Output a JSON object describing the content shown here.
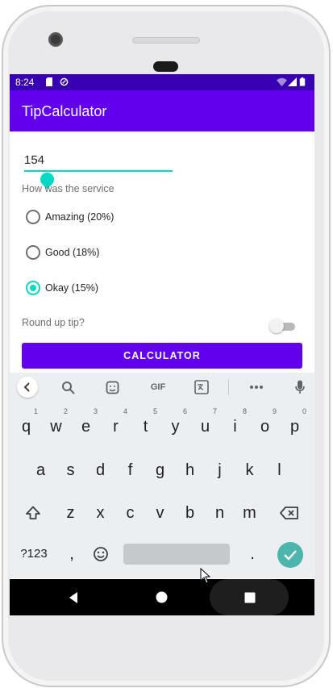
{
  "status_bar": {
    "time": "8:24",
    "color": "#3700b3"
  },
  "app_bar": {
    "title": "TipCalculator",
    "color": "#6200ee"
  },
  "form": {
    "amount_value": "154",
    "service_question": "How was the service",
    "options": [
      {
        "label": "Amazing (20%)",
        "selected": false
      },
      {
        "label": "Good (18%)",
        "selected": false
      },
      {
        "label": "Okay (15%)",
        "selected": true
      }
    ],
    "round_up_label": "Round up tip?",
    "round_up_on": false,
    "calculate_label": "CALCULATOR",
    "accent_color": "#03dac5"
  },
  "keyboard": {
    "toolbar": {
      "gif_label": "GIF"
    },
    "row1": [
      {
        "key": "q",
        "hint": "1"
      },
      {
        "key": "w",
        "hint": "2"
      },
      {
        "key": "e",
        "hint": "3"
      },
      {
        "key": "r",
        "hint": "4"
      },
      {
        "key": "t",
        "hint": "5"
      },
      {
        "key": "y",
        "hint": "6"
      },
      {
        "key": "u",
        "hint": "7"
      },
      {
        "key": "i",
        "hint": "8"
      },
      {
        "key": "o",
        "hint": "9"
      },
      {
        "key": "p",
        "hint": "0"
      }
    ],
    "row2": [
      "a",
      "s",
      "d",
      "f",
      "g",
      "h",
      "j",
      "k",
      "l"
    ],
    "row3": [
      "z",
      "x",
      "c",
      "v",
      "b",
      "n",
      "m"
    ],
    "symbols_label": "?123",
    "comma": ",",
    "period": ".",
    "enter_color": "#4db6ac"
  }
}
